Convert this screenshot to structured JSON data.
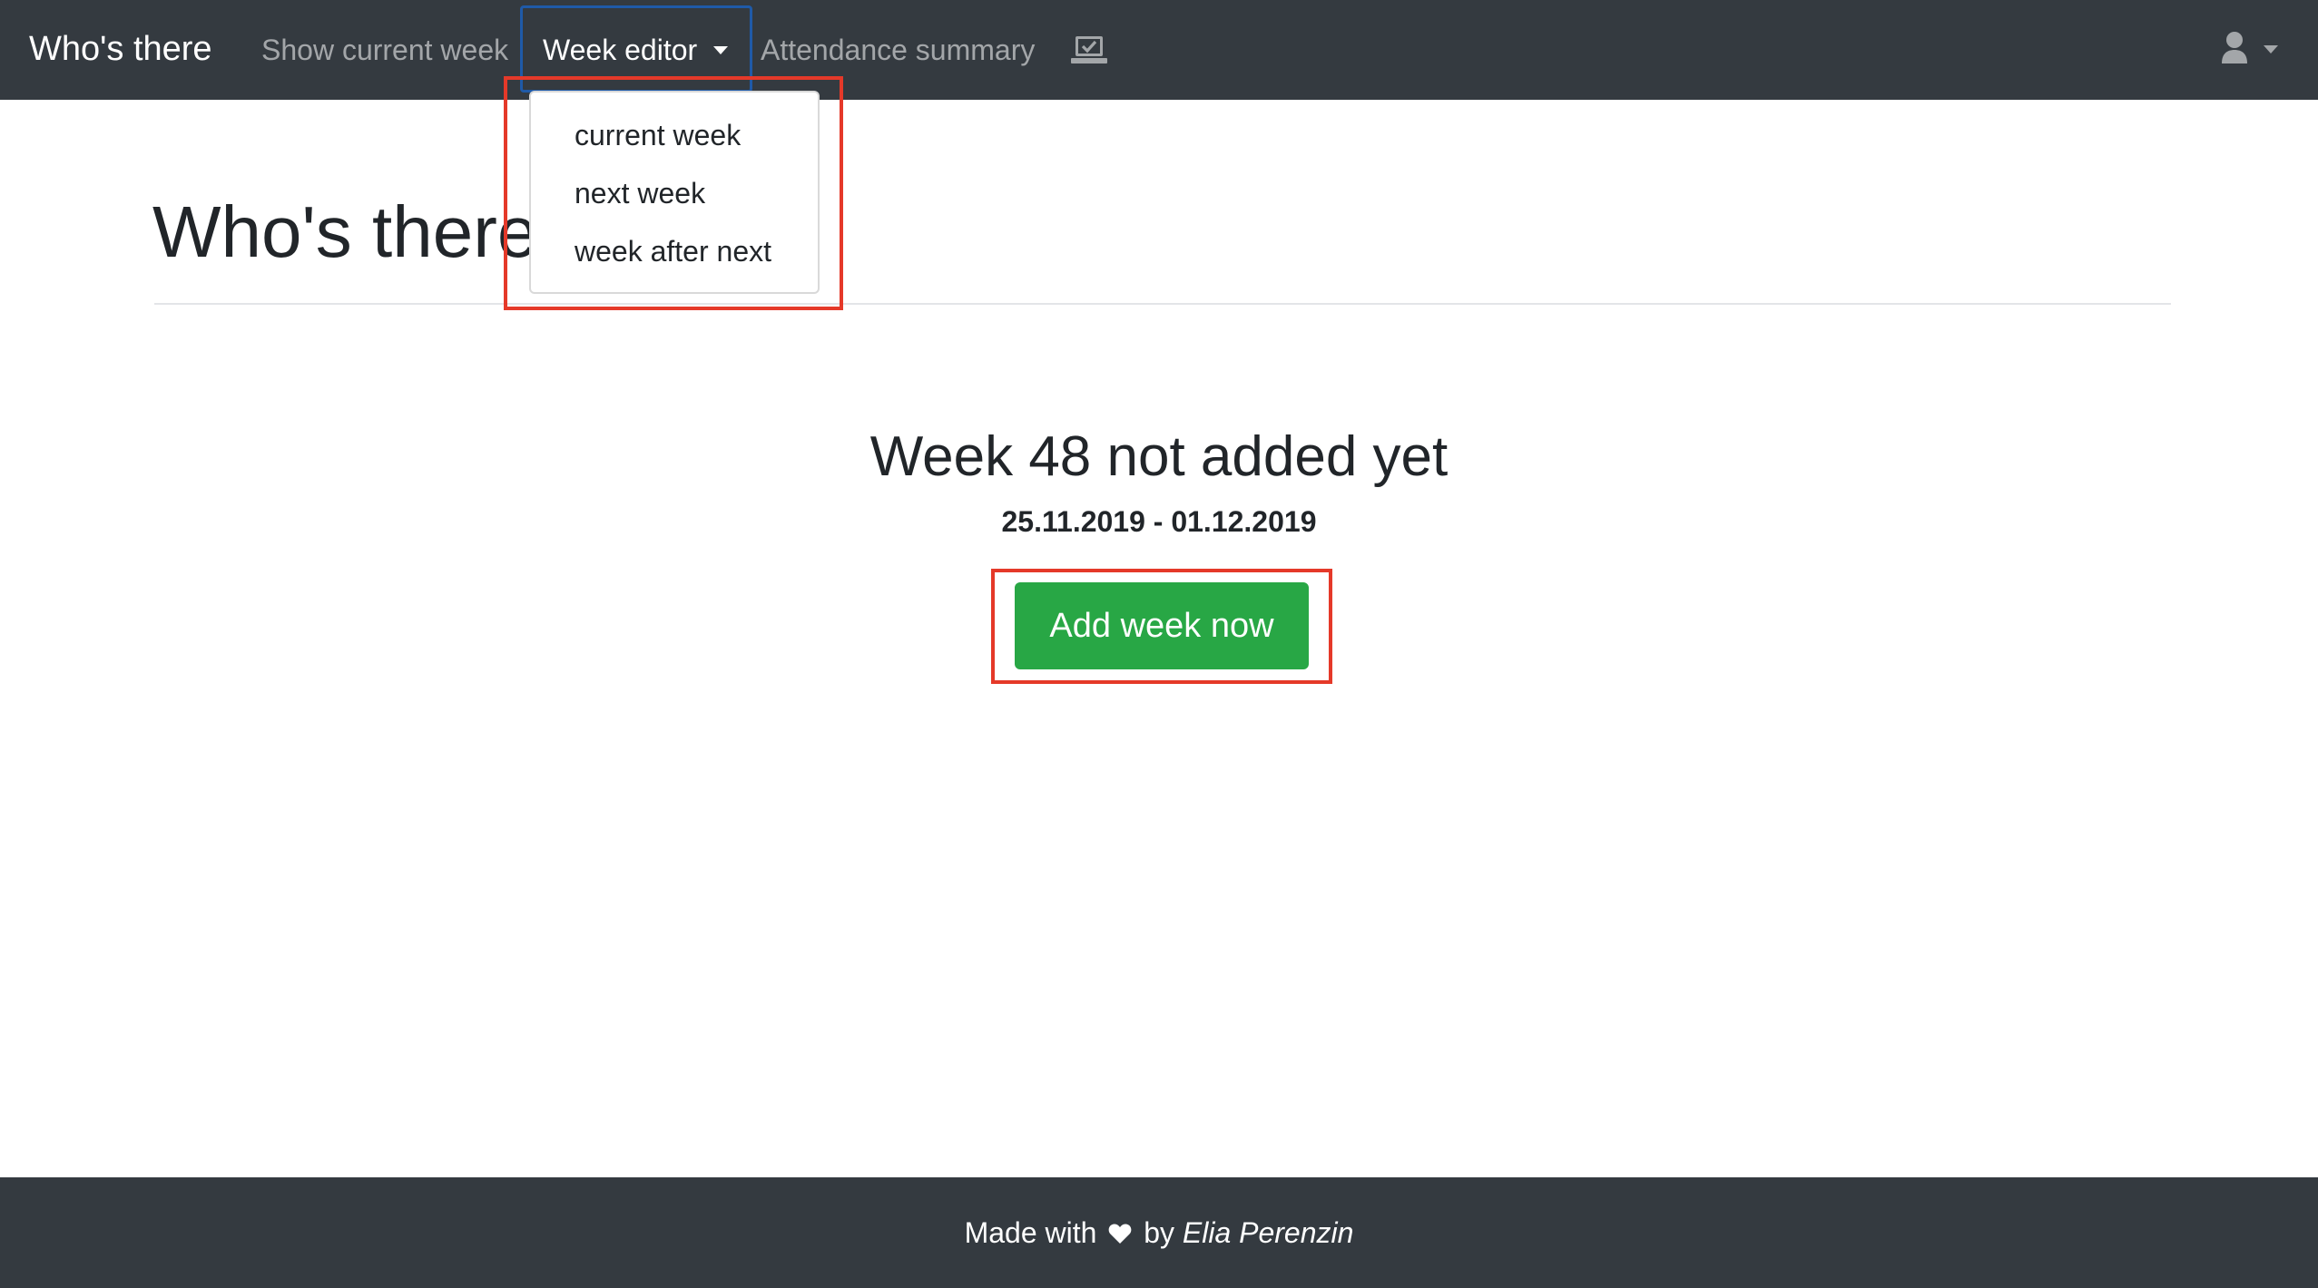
{
  "navbar": {
    "brand": "Who's there",
    "links": {
      "show_current_week": "Show current week",
      "week_editor": "Week editor",
      "attendance_summary": "Attendance summary"
    },
    "laptop_icon": "laptop-check-icon",
    "user_icon": "user-icon",
    "background_color": "#343a40"
  },
  "dropdown": {
    "items": [
      "current week",
      "next week",
      "week after next"
    ]
  },
  "main": {
    "title": "Who's there",
    "status_heading": "Week 48 not added yet",
    "date_range": "25.11.2019 - 01.12.2019",
    "add_button_label": "Add week now",
    "button_color": "#28a745"
  },
  "annotations": {
    "highlight_color": "#e53929",
    "focus_color": "#1f5aa8"
  },
  "footer": {
    "made_with": "Made with",
    "by": "by",
    "author": "Elia Perenzin",
    "heart_icon": "heart-icon"
  }
}
